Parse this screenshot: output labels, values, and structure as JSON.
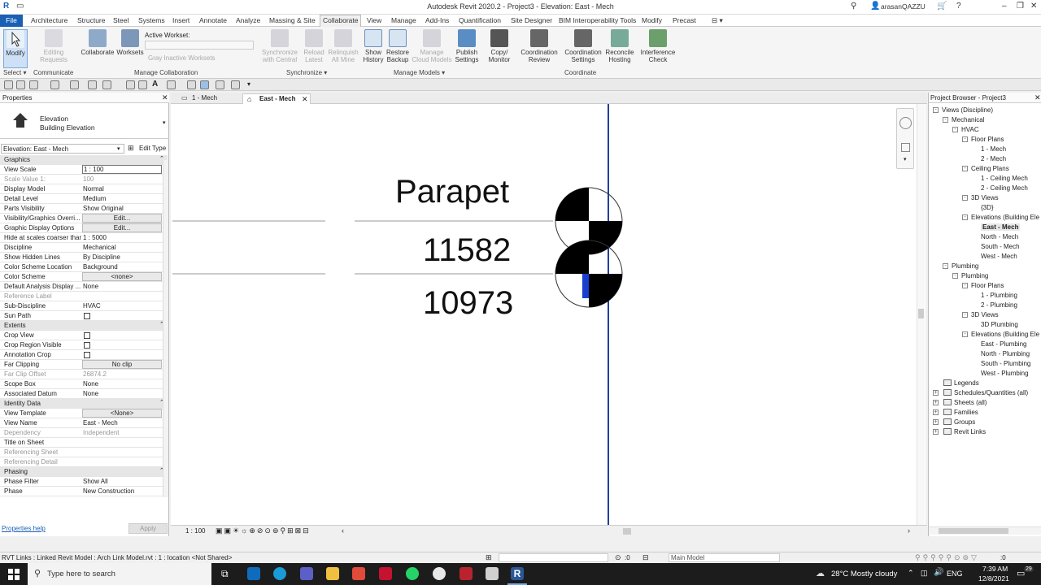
{
  "titlebar": {
    "title": "Autodesk Revit 2020.2 - Project3 - Elevation: East - Mech",
    "user": "arasanQAZZU"
  },
  "menu": [
    "File",
    "Architecture",
    "Structure",
    "Steel",
    "Systems",
    "Insert",
    "Annotate",
    "Analyze",
    "Massing & Site",
    "Collaborate",
    "View",
    "Manage",
    "Add-Ins",
    "Quantification",
    "Site Designer",
    "BIM Interoperability Tools",
    "Modify",
    "Precast"
  ],
  "ribbon": {
    "modify": "Modify",
    "select": "Select",
    "communicate": "Communicate",
    "editing_requests": "Editing Requests",
    "collaborate": "Collaborate",
    "worksets": "Worksets",
    "active_workset": "Active Workset:",
    "gray_inactive": "Gray Inactive Worksets",
    "manage_collaboration": "Manage Collaboration",
    "sync_central": "Synchronize with Central",
    "reload_latest": "Reload Latest",
    "relinquish_all": "Relinquish All Mine",
    "synchronize": "Synchronize",
    "show_history": "Show History",
    "restore_backup": "Restore Backup",
    "manage_cloud": "Manage Cloud Models",
    "publish_settings": "Publish Settings",
    "manage_models": "Manage Models",
    "copy_monitor": "Copy/ Monitor",
    "coordination_review": "Coordination Review",
    "coordination_settings": "Coordination Settings",
    "reconcile_hosting": "Reconcile Hosting",
    "interference_check": "Interference Check",
    "coordinate": "Coordinate"
  },
  "properties": {
    "header": "Properties",
    "type_name": "Elevation",
    "type_sub": "Building Elevation",
    "selector": "Elevation: East - Mech",
    "edit_type": "Edit Type",
    "rows": [
      {
        "k": "Graphics",
        "hdr": true
      },
      {
        "k": "View Scale",
        "v": "1 : 100",
        "input": true
      },
      {
        "k": "Scale Value    1:",
        "v": "100",
        "gray": true
      },
      {
        "k": "Display Model",
        "v": "Normal"
      },
      {
        "k": "Detail Level",
        "v": "Medium"
      },
      {
        "k": "Parts Visibility",
        "v": "Show Original"
      },
      {
        "k": "Visibility/Graphics Overri...",
        "v": "Edit...",
        "btn": true
      },
      {
        "k": "Graphic Display Options",
        "v": "Edit...",
        "btn": true
      },
      {
        "k": "Hide at scales coarser than",
        "v": "1 : 5000"
      },
      {
        "k": "Discipline",
        "v": "Mechanical"
      },
      {
        "k": "Show Hidden Lines",
        "v": "By Discipline"
      },
      {
        "k": "Color Scheme Location",
        "v": "Background"
      },
      {
        "k": "Color Scheme",
        "v": "<none>",
        "btn": true
      },
      {
        "k": "Default Analysis Display ...",
        "v": "None"
      },
      {
        "k": "Reference Label",
        "v": "",
        "gray": true
      },
      {
        "k": "Sub-Discipline",
        "v": "HVAC"
      },
      {
        "k": "Sun Path",
        "v": "",
        "chk": true
      },
      {
        "k": "Extents",
        "hdr": true
      },
      {
        "k": "Crop View",
        "v": "",
        "chk": true
      },
      {
        "k": "Crop Region Visible",
        "v": "",
        "chk": true
      },
      {
        "k": "Annotation Crop",
        "v": "",
        "chk": true
      },
      {
        "k": "Far Clipping",
        "v": "No clip",
        "btn": true
      },
      {
        "k": "Far Clip Offset",
        "v": "26874.2",
        "gray": true
      },
      {
        "k": "Scope Box",
        "v": "None"
      },
      {
        "k": "Associated Datum",
        "v": "None"
      },
      {
        "k": "Identity Data",
        "hdr": true
      },
      {
        "k": "View Template",
        "v": "<None>",
        "btn": true
      },
      {
        "k": "View Name",
        "v": "East - Mech"
      },
      {
        "k": "Dependency",
        "v": "Independent",
        "gray": true
      },
      {
        "k": "Title on Sheet",
        "v": ""
      },
      {
        "k": "Referencing Sheet",
        "v": "",
        "gray": true
      },
      {
        "k": "Referencing Detail",
        "v": "",
        "gray": true
      },
      {
        "k": "Phasing",
        "hdr": true
      },
      {
        "k": "Phase Filter",
        "v": "Show All"
      },
      {
        "k": "Phase",
        "v": "New Construction"
      }
    ],
    "help": "Properties help",
    "apply": "Apply"
  },
  "tabs": [
    {
      "label": "1 - Mech",
      "active": false
    },
    {
      "label": "East - Mech",
      "active": true
    }
  ],
  "canvas": {
    "level_name": "Parapet",
    "elev1": "11582",
    "elev2": "10973"
  },
  "browser": {
    "header": "Project Browser - Project3",
    "nodes": [
      {
        "t": "Views (Discipline)",
        "d": 0,
        "exp": "-"
      },
      {
        "t": "Mechanical",
        "d": 1,
        "exp": "-"
      },
      {
        "t": "HVAC",
        "d": 2,
        "exp": "-"
      },
      {
        "t": "Floor Plans",
        "d": 3,
        "exp": "-"
      },
      {
        "t": "1 - Mech",
        "d": 4
      },
      {
        "t": "2 - Mech",
        "d": 4
      },
      {
        "t": "Ceiling Plans",
        "d": 3,
        "exp": "-"
      },
      {
        "t": "1 - Ceiling Mech",
        "d": 4
      },
      {
        "t": "2 - Ceiling Mech",
        "d": 4
      },
      {
        "t": "3D Views",
        "d": 3,
        "exp": "-"
      },
      {
        "t": "{3D}",
        "d": 4
      },
      {
        "t": "Elevations (Building Ele",
        "d": 3,
        "exp": "-"
      },
      {
        "t": "East - Mech",
        "d": 4,
        "sel": true
      },
      {
        "t": "North - Mech",
        "d": 4
      },
      {
        "t": "South - Mech",
        "d": 4
      },
      {
        "t": "West - Mech",
        "d": 4
      },
      {
        "t": "Plumbing",
        "d": 1,
        "exp": "-"
      },
      {
        "t": "Plumbing",
        "d": 2,
        "exp": "-"
      },
      {
        "t": "Floor Plans",
        "d": 3,
        "exp": "-"
      },
      {
        "t": "1 - Plumbing",
        "d": 4
      },
      {
        "t": "2 - Plumbing",
        "d": 4
      },
      {
        "t": "3D Views",
        "d": 3,
        "exp": "-"
      },
      {
        "t": "3D Plumbing",
        "d": 4
      },
      {
        "t": "Elevations (Building Ele",
        "d": 3,
        "exp": "-"
      },
      {
        "t": "East - Plumbing",
        "d": 4
      },
      {
        "t": "North - Plumbing",
        "d": 4
      },
      {
        "t": "South - Plumbing",
        "d": 4
      },
      {
        "t": "West - Plumbing",
        "d": 4
      },
      {
        "t": "Legends",
        "d": 0,
        "icon": true
      },
      {
        "t": "Schedules/Quantities (all)",
        "d": 0,
        "exp": "+",
        "icon": true
      },
      {
        "t": "Sheets (all)",
        "d": 0,
        "exp": "+",
        "icon": true
      },
      {
        "t": "Families",
        "d": 0,
        "exp": "+",
        "icon": true
      },
      {
        "t": "Groups",
        "d": 0,
        "exp": "+",
        "icon": true
      },
      {
        "t": "Revit Links",
        "d": 0,
        "exp": "+",
        "icon": true
      }
    ]
  },
  "viewctl": {
    "scale": "1 : 100"
  },
  "status": {
    "text": "RVT Links : Linked Revit Model : Arch Link Model.rvt : 1 : location <Not Shared>",
    "zero": ":0",
    "model": "Main Model"
  },
  "taskbar": {
    "search": "Type here to search",
    "weather": "28°C  Mostly cloudy",
    "lang": "ENG",
    "time": "7:39 AM",
    "date": "12/8/2021",
    "notif": "29"
  }
}
